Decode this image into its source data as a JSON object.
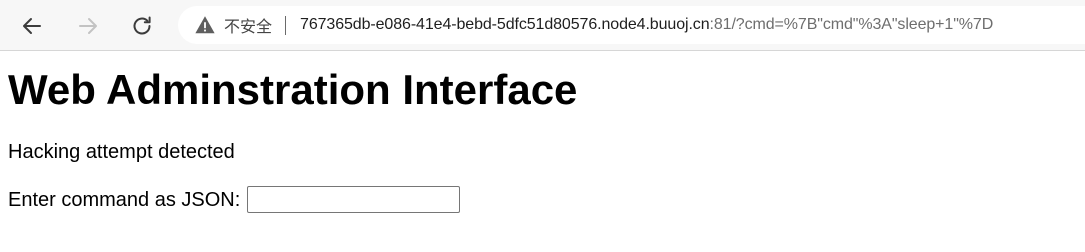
{
  "browser": {
    "security_label": "不安全",
    "address": {
      "host": "767365db-e086-41e4-bebd-5dfc51d80576.node4.buuoj.cn",
      "rest": ":81/?cmd=%7B\"cmd\"%3A\"sleep+1\"%7D"
    }
  },
  "page": {
    "title": "Web Adminstration Interface",
    "message": "Hacking attempt detected",
    "command_label": "Enter command as JSON:",
    "command_value": ""
  }
}
